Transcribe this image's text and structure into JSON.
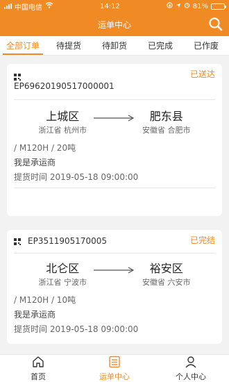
{
  "status_bar": {
    "carrier": "中国电信",
    "time": "14:12",
    "battery": "81%"
  },
  "header": {
    "title": "运单中心"
  },
  "tabs": [
    {
      "label": "全部订单"
    },
    {
      "label": "待提货"
    },
    {
      "label": "待卸货"
    },
    {
      "label": "已完成"
    },
    {
      "label": "已作废"
    }
  ],
  "orders": [
    {
      "order_no": "EP69620190517000001",
      "status": "已送达",
      "from_city": "上城区",
      "from_prov": "浙江省 杭州市",
      "to_city": "肥东县",
      "to_prov": "安徽省 合肥市",
      "vehicle": "/ M120H / 20吨",
      "carrier": "我是承运商",
      "pickup": "提货时间 2019-05-18 09:00:00"
    },
    {
      "order_no": "EP3511905170005",
      "status": "已完结",
      "from_city": "北仑区",
      "from_prov": "浙江省 宁波市",
      "to_city": "裕安区",
      "to_prov": "安徽省 六安市",
      "vehicle": "/ M120H / 10吨",
      "carrier": "我是承运商",
      "pickup": "提货时间 2019-05-18 09:00:00"
    }
  ],
  "bottom_nav": [
    {
      "label": "首页",
      "icon": "home-icon"
    },
    {
      "label": "运单中心",
      "icon": "list-icon"
    },
    {
      "label": "个人中心",
      "icon": "user-icon"
    }
  ],
  "colors": {
    "accent": "#f08a24"
  }
}
